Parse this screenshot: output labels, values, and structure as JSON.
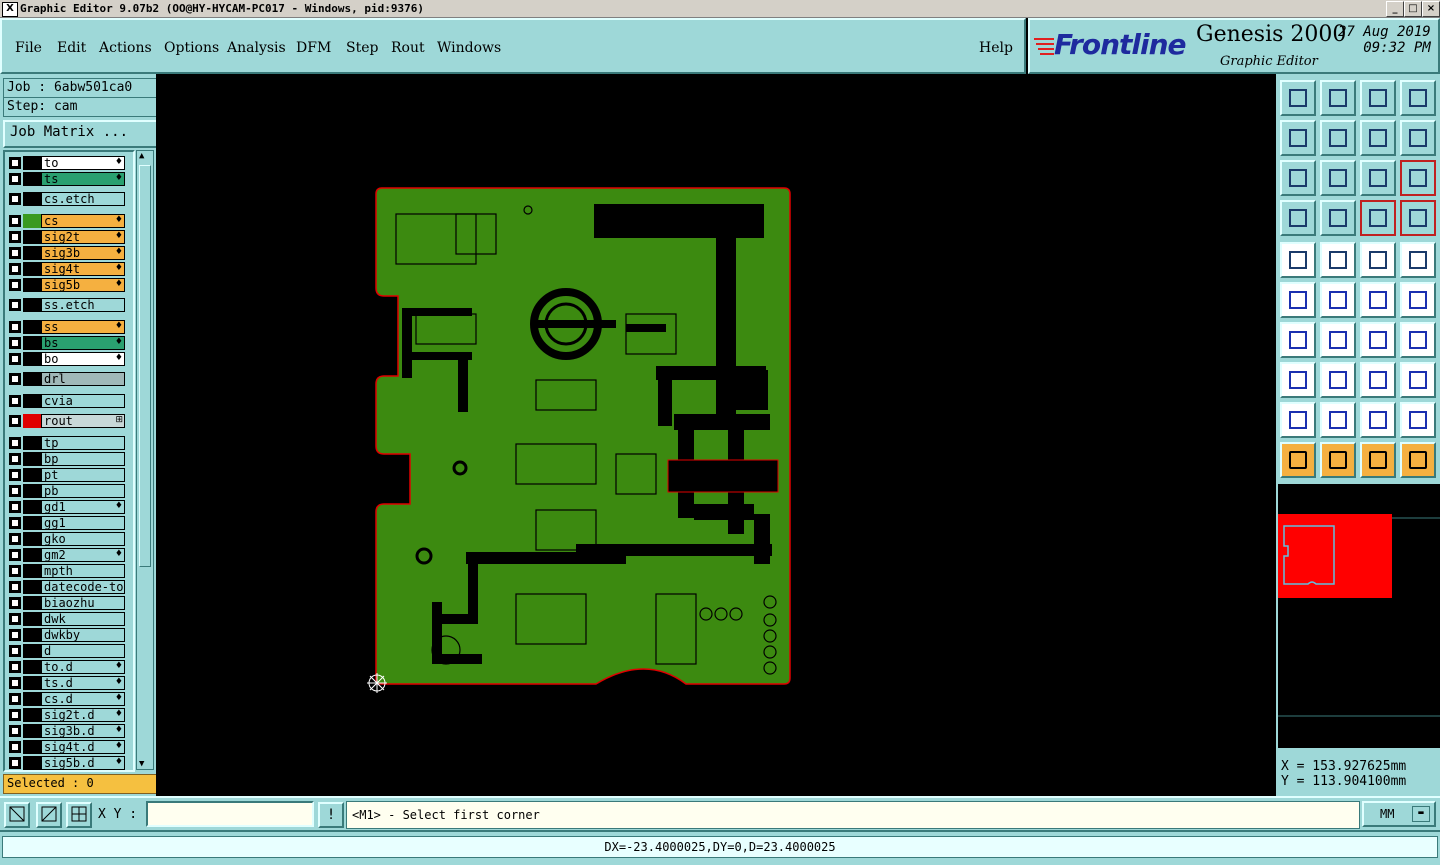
{
  "window": {
    "title": "Graphic Editor 9.07b2 (OO@HY-HYCAM-PC017 - Windows, pid:9376)",
    "app_icon": "X",
    "buttons": [
      "_",
      "□",
      "×"
    ]
  },
  "menu": {
    "items": [
      "File",
      "Edit",
      "Actions",
      "Options",
      "Analysis",
      "DFM",
      "Step",
      "Rout",
      "Windows"
    ],
    "help": "Help"
  },
  "brand": {
    "logo": "Frontline",
    "product": "Genesis 2000",
    "subtitle": "Graphic Editor",
    "date": "27 Aug 2019",
    "time": "09:32 PM"
  },
  "job": {
    "job_label": "Job : 6abw501ca0",
    "step_label": "Step: cam",
    "matrix_button": "Job Matrix ..."
  },
  "layers": [
    {
      "name": "to",
      "fill": "#ffffff",
      "swatch": "#000000",
      "mark": "♦"
    },
    {
      "name": "ts",
      "fill": "#2aa070",
      "swatch": "#000000",
      "mark": "♦"
    },
    {
      "name": "cs.etch",
      "fill": "#9ed8d8",
      "swatch": "#000000",
      "mark": ""
    },
    {
      "name": "cs",
      "fill": "#f5b040",
      "swatch": "#3a9a20",
      "mark": "♦"
    },
    {
      "name": "sig2t",
      "fill": "#f5b040",
      "swatch": "#000000",
      "mark": "♦"
    },
    {
      "name": "sig3b",
      "fill": "#f5b040",
      "swatch": "#000000",
      "mark": "♦"
    },
    {
      "name": "sig4t",
      "fill": "#f5b040",
      "swatch": "#000000",
      "mark": "♦"
    },
    {
      "name": "sig5b",
      "fill": "#f5b040",
      "swatch": "#000000",
      "mark": "♦"
    },
    {
      "name": "ss.etch",
      "fill": "#9ed8d8",
      "swatch": "#000000",
      "mark": ""
    },
    {
      "name": "ss",
      "fill": "#f5b040",
      "swatch": "#000000",
      "mark": "♦"
    },
    {
      "name": "bs",
      "fill": "#2aa070",
      "swatch": "#000000",
      "mark": "♦"
    },
    {
      "name": "bo",
      "fill": "#ffffff",
      "swatch": "#000000",
      "mark": "♦"
    },
    {
      "name": "drl",
      "fill": "#a0b8b8",
      "swatch": "#000000",
      "mark": ""
    },
    {
      "name": "cvia",
      "fill": "#9ed8d8",
      "swatch": "#000000",
      "mark": ""
    },
    {
      "name": "rout",
      "fill": "#c8d8d8",
      "swatch": "#e00000",
      "mark": "⊞"
    },
    {
      "name": "tp",
      "fill": "#9ed8d8",
      "swatch": "#000000",
      "mark": ""
    },
    {
      "name": "bp",
      "fill": "#9ed8d8",
      "swatch": "#000000",
      "mark": ""
    },
    {
      "name": "pt",
      "fill": "#9ed8d8",
      "swatch": "#000000",
      "mark": ""
    },
    {
      "name": "pb",
      "fill": "#9ed8d8",
      "swatch": "#000000",
      "mark": ""
    },
    {
      "name": "gd1",
      "fill": "#9ed8d8",
      "swatch": "#000000",
      "mark": "♦"
    },
    {
      "name": "gg1",
      "fill": "#9ed8d8",
      "swatch": "#000000",
      "mark": ""
    },
    {
      "name": "gko",
      "fill": "#9ed8d8",
      "swatch": "#000000",
      "mark": ""
    },
    {
      "name": "gm2",
      "fill": "#9ed8d8",
      "swatch": "#000000",
      "mark": "♦"
    },
    {
      "name": "mpth",
      "fill": "#9ed8d8",
      "swatch": "#000000",
      "mark": ""
    },
    {
      "name": "datecode-to",
      "fill": "#9ed8d8",
      "swatch": "#000000",
      "mark": ""
    },
    {
      "name": "biaozhu",
      "fill": "#9ed8d8",
      "swatch": "#000000",
      "mark": ""
    },
    {
      "name": "dwk",
      "fill": "#9ed8d8",
      "swatch": "#000000",
      "mark": ""
    },
    {
      "name": "dwkby",
      "fill": "#9ed8d8",
      "swatch": "#000000",
      "mark": ""
    },
    {
      "name": "d",
      "fill": "#9ed8d8",
      "swatch": "#000000",
      "mark": ""
    },
    {
      "name": "to.d",
      "fill": "#9ed8d8",
      "swatch": "#000000",
      "mark": "♦"
    },
    {
      "name": "ts.d",
      "fill": "#9ed8d8",
      "swatch": "#000000",
      "mark": "♦"
    },
    {
      "name": "cs.d",
      "fill": "#9ed8d8",
      "swatch": "#000000",
      "mark": "♦"
    },
    {
      "name": "sig2t.d",
      "fill": "#9ed8d8",
      "swatch": "#000000",
      "mark": "♦"
    },
    {
      "name": "sig3b.d",
      "fill": "#9ed8d8",
      "swatch": "#000000",
      "mark": "♦"
    },
    {
      "name": "sig4t.d",
      "fill": "#9ed8d8",
      "swatch": "#000000",
      "mark": "♦"
    },
    {
      "name": "sig5b.d",
      "fill": "#9ed8d8",
      "swatch": "#000000",
      "mark": "♦"
    }
  ],
  "selected": "Selected : 0",
  "coords": {
    "x": "X = 153.927625mm",
    "y": "Y = 113.904100mm"
  },
  "xy": {
    "label": "X Y :",
    "value": "",
    "warn_icon": "!"
  },
  "prompt": "<M1> - Select first corner",
  "units": {
    "selected": "MM"
  },
  "status": "DX=-23.4000025,DY=0,D=23.4000025",
  "toolbar_icons": [
    "zoom-home-icon",
    "zoom-page-icon",
    "home-icon",
    "split-view-icon",
    "pan-left-icon",
    "pan-right-icon",
    "flip-icon",
    "mirror-s-icon",
    "fit-icon",
    "center-icon",
    "scale-1-2-icon",
    "help-icon",
    "measure-tools-icon",
    "probe-icon",
    "layer-switch-icon",
    "layer-compare-icon",
    "snapshot-icon",
    "edit-shape-icon",
    "ruler-icon",
    "circle-icon",
    "connect-nodes-icon",
    "close-cross-icon",
    "add-arc-icon",
    "add-line-icon",
    "angle-icon",
    "slash-line-icon",
    "arc-rotate-icon",
    "pad-icon",
    "move-node-icon",
    "dash-icon",
    "dimension-icon",
    "blobs-icon",
    "triangle-icon",
    "triangle-a-icon",
    "triangle-a-arc-icon",
    "triangle-arrow-icon",
    "cursor-icon",
    "cursor-box-icon",
    "cursor-circle-icon",
    "route-icon"
  ],
  "colors": {
    "panel": "#9ed8d8",
    "board": "#3c8a10",
    "board_outline": "#e00000",
    "selected_bg": "#f5c040"
  }
}
